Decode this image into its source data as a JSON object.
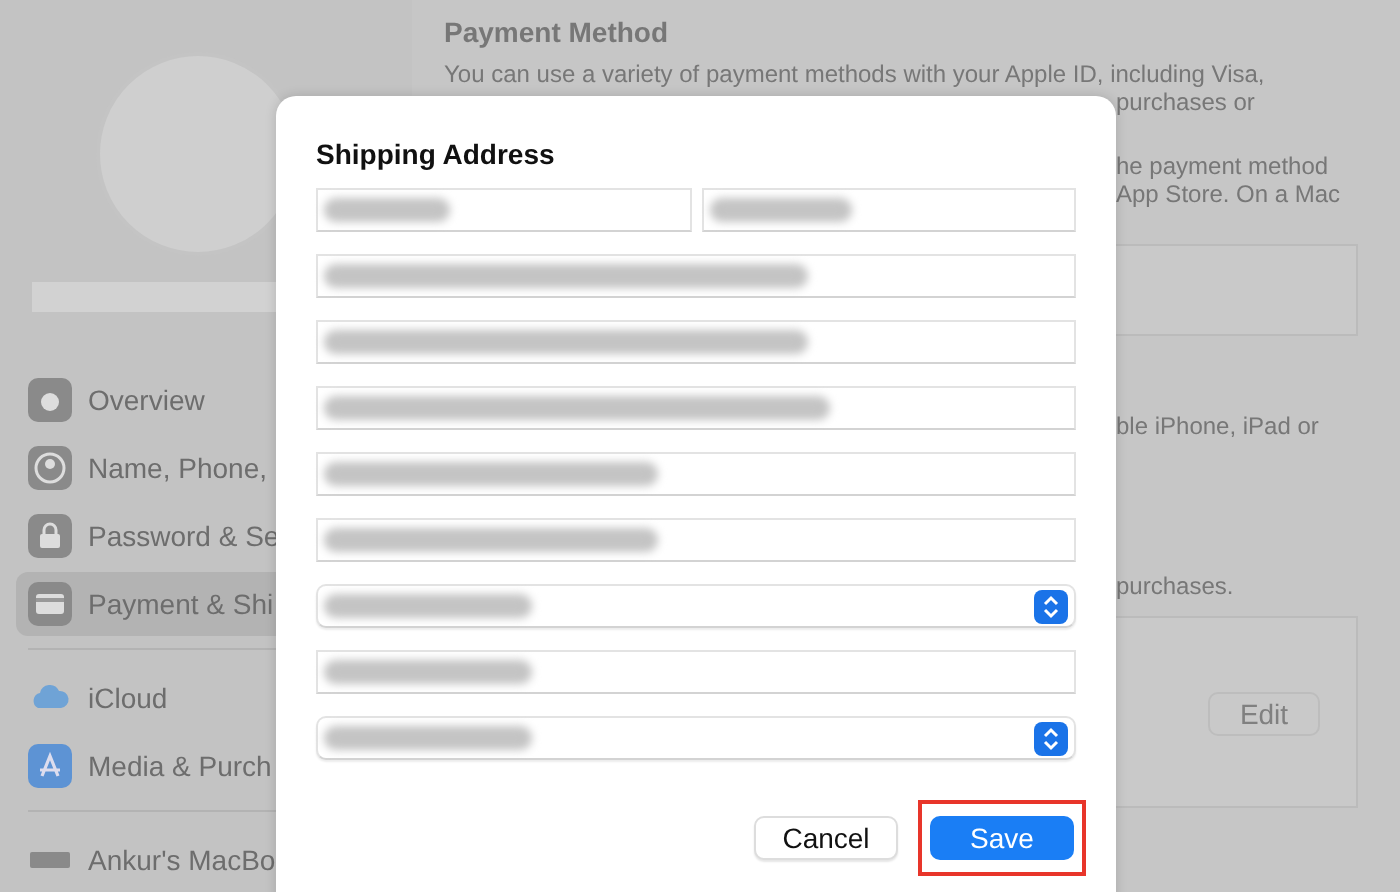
{
  "sidebar": {
    "groups": [
      {
        "items": [
          {
            "label": "Overview",
            "selected": false
          },
          {
            "label": "Name, Phone,",
            "selected": false
          },
          {
            "label": "Password & Se",
            "selected": false
          },
          {
            "label": "Payment & Shi",
            "selected": true
          }
        ]
      },
      {
        "items": [
          {
            "label": "iCloud",
            "selected": false
          },
          {
            "label": "Media & Purch",
            "selected": false
          }
        ]
      },
      {
        "items": [
          {
            "label": "Ankur's MacBo",
            "selected": false
          }
        ]
      }
    ]
  },
  "main": {
    "title": "Payment Method",
    "intro": "You can use a variety of payment methods with your Apple ID, including Visa,",
    "fragments": [
      "purchases or",
      "he payment method",
      "App Store. On a Mac"
    ],
    "fragments_2": [
      "ble iPhone, iPad or"
    ],
    "fragments_3": [
      "purchases."
    ],
    "edit_button": "Edit"
  },
  "dialog": {
    "title": "Shipping Address",
    "rows": [
      [
        {
          "kind": "text"
        },
        {
          "kind": "text"
        }
      ],
      [
        {
          "kind": "text"
        }
      ],
      [
        {
          "kind": "text"
        }
      ],
      [
        {
          "kind": "text"
        }
      ],
      [
        {
          "kind": "text"
        }
      ],
      [
        {
          "kind": "text"
        }
      ],
      [
        {
          "kind": "popup"
        }
      ],
      [
        {
          "kind": "text"
        }
      ],
      [
        {
          "kind": "popup"
        }
      ]
    ],
    "buttons": [
      {
        "label": "Cancel",
        "kind": "secondary",
        "highlighted": false
      },
      {
        "label": "Save",
        "kind": "primary",
        "highlighted": true
      }
    ]
  }
}
